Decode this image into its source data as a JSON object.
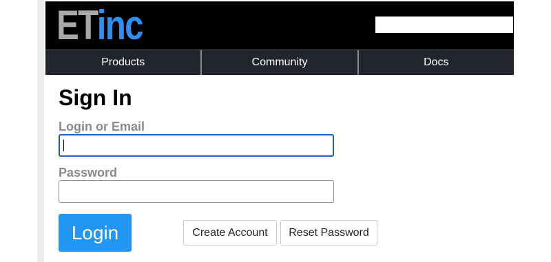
{
  "brand": {
    "logo_part1": "ET",
    "logo_part2": "inc"
  },
  "header": {
    "search_value": ""
  },
  "nav": {
    "items": [
      "Products",
      "Community",
      "Docs"
    ]
  },
  "form": {
    "title": "Sign In",
    "login_label": "Login or Email",
    "login_value": "",
    "password_label": "Password",
    "password_value": "",
    "login_button": "Login",
    "create_account_button": "Create Account",
    "reset_password_button": "Reset Password"
  },
  "colors": {
    "header_bg": "#000000",
    "nav_bg": "#23252c",
    "logo_gray": "#a9a9a9",
    "logo_blue": "#2f8ff0",
    "primary_button": "#2196f3",
    "focus_border": "#1f5fbf"
  }
}
